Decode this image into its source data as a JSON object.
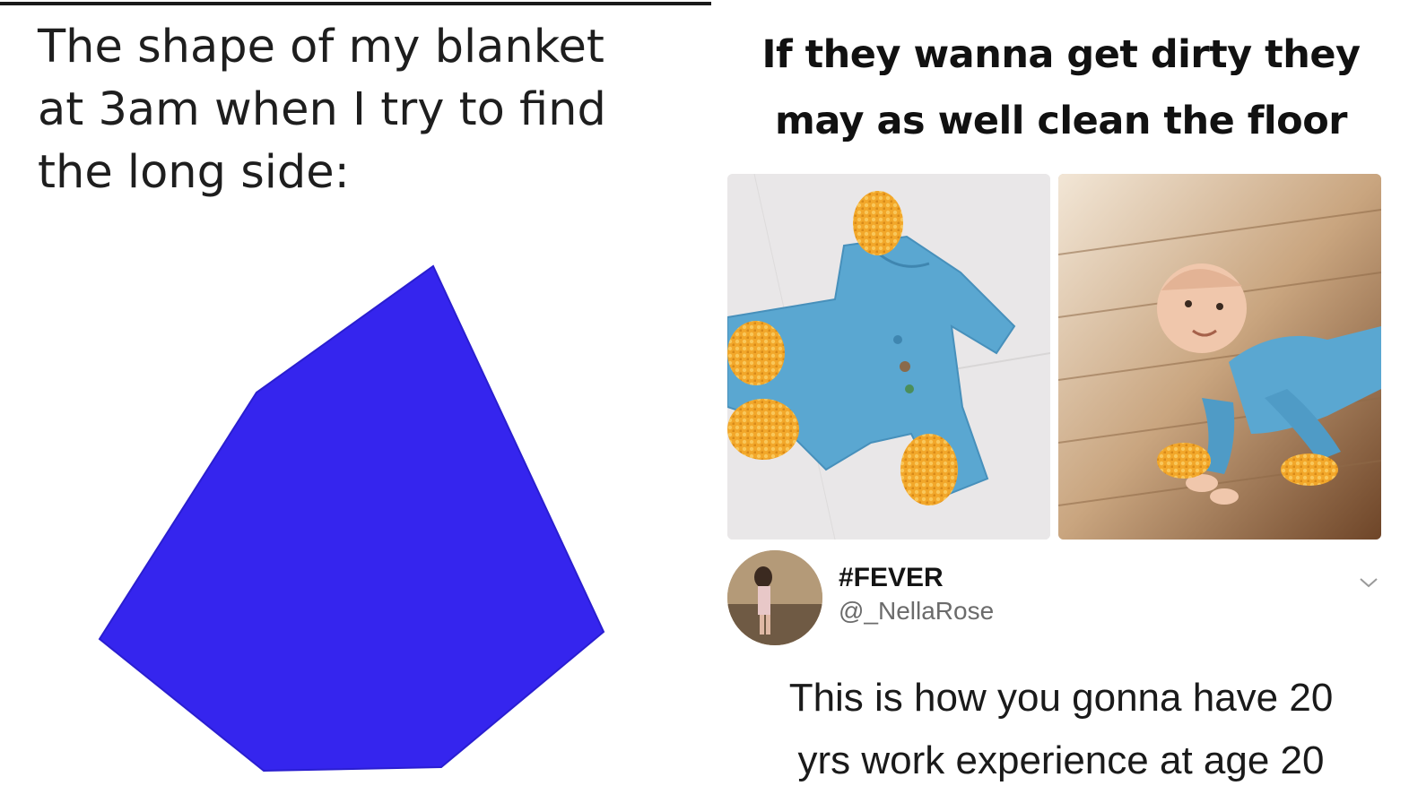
{
  "left_meme": {
    "caption_lines": [
      "The shape of my blanket",
      "at 3am when I try to find",
      "the long side:"
    ],
    "shape_color": "#3525ee"
  },
  "right_meme": {
    "caption_lines": [
      "If they wanna get dirty they",
      "may as well clean the floor"
    ],
    "tweet": {
      "display_name": "#FEVER",
      "handle": "@_NellaRose",
      "text_lines": [
        "This is how you gonna have 20",
        "yrs work experience at age 20"
      ],
      "menu_icon": "chevron-down-icon"
    },
    "colors": {
      "romper_blue": "#5aa7d1",
      "mop_orange": "#f2a72a"
    }
  }
}
